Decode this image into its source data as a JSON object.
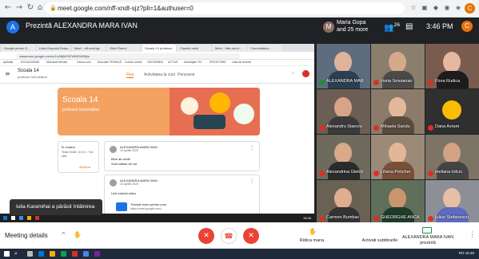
{
  "browser": {
    "url": "meet.google.com/nff-xndt-sjz?pli=1&authuser=0",
    "nav": {
      "back": "←",
      "forward": "→",
      "reload": "↻",
      "home": "⌂"
    },
    "profile_initial": "C"
  },
  "meet_top": {
    "presenter_initial": "A",
    "presenter_label": "Prezintă ALEXANDRA MARA IVAN",
    "people_initial": "M",
    "people_line1": "Maria Gopa",
    "people_line2": "and 25 more",
    "participants_count": "26",
    "clock": "3:46 PM",
    "me_initial": "C"
  },
  "shared_screen": {
    "tabs": [
      "Google pentru E...",
      "Lista Grupului Didac...",
      "Meet - nff-xndt-sjz",
      "Ghid Fluent...",
      "Scoala 14 profesori",
      "Clasele mele",
      "Meet - hike-acmf...",
      "Comunitatea..."
    ],
    "url": "classroom.google.com/u/1/c/MjM2NTk0NDk3NjIw",
    "bookmarks": [
      "Aplicații",
      "EXCALIDRAW",
      "Microsoft Stream",
      "Canva.com",
      "Educație TEHNICĂ",
      "Cursuri online",
      "GEOGEBRA",
      "ACTIVE",
      "Avantajele TIC",
      "PROSTORIE",
      "Lista de lectură"
    ],
    "classroom": {
      "class_name": "Scoala 14",
      "class_sub": "profesori îndrumători",
      "tabs": {
        "stream": "Flux",
        "classwork": "Activitatea la curs",
        "people": "Persoane"
      },
      "banner_title": "Scoala 14",
      "banner_sub": "profesori îndrumători",
      "upcoming_title": "În curând",
      "upcoming_text": "Textul limită: 10.04 • 7 lec rălie",
      "upcoming_link": "Afișați tot",
      "post1": {
        "author": "ALEXANDRA MARA IVAN",
        "date": "10 aprilie 2020",
        "body_1": "Bine ați venit!",
        "body_2": "Sunt alături de voi."
      },
      "post2": {
        "author": "ALEXANDRA MARA IVAN",
        "date": "10 aprilie 2020",
        "body_1": "Link tutorial video",
        "attachment_title": "Tutorial video pentru curs",
        "attachment_url": "https://meet.google.com/..."
      }
    },
    "tray_time": "15:46"
  },
  "toast": {
    "text": "Iulia Karamihai a părăsit întâlnirea"
  },
  "tiles": [
    {
      "name": "ALEXANDRA MAR",
      "speaking": true
    },
    {
      "name": "Horia Smoiarian",
      "speaking": false
    },
    {
      "name": "Flora Rudica",
      "speaking": false
    },
    {
      "name": "Alexandru Stanciu",
      "speaking": false
    },
    {
      "name": "Mihaela Sandu",
      "speaking": false
    },
    {
      "name": "Dana Avram",
      "speaking": false
    },
    {
      "name": "Alexandrina Gletch",
      "speaking": false
    },
    {
      "name": "Liliana Peticher",
      "speaking": false
    },
    {
      "name": "eteliana Iofciu",
      "speaking": false
    },
    {
      "name": "Carmen Bumbac",
      "speaking": false
    },
    {
      "name": "GHEORGHE ANCA",
      "speaking": false
    },
    {
      "name": "Iulius Stefanescu",
      "speaking": false
    }
  ],
  "bottom_bar": {
    "meeting_details": "Meeting details",
    "chevron": "^",
    "mic": "✕",
    "leave": "☎",
    "camera": "✕",
    "raise_hand": "Ridica mana",
    "captions": "Activati subtitrarile",
    "presenting_name": "ALEXANDRA MARA IVAN",
    "presenting_state": "prezintă",
    "more": "⋮"
  },
  "windows_taskbar": {
    "tray": "RO  15:46"
  },
  "colors": {
    "meet_dark": "#202124",
    "red": "#ea4335",
    "classroom_orange": "#e8710a",
    "banner": "#f4a261"
  }
}
